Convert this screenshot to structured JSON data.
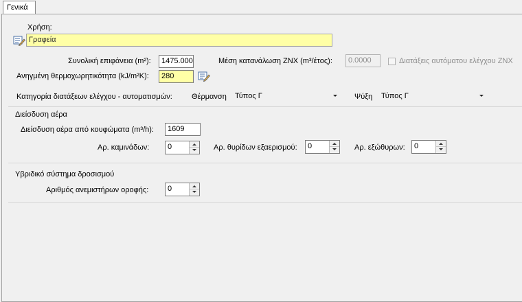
{
  "tab": {
    "label": "Γενικά"
  },
  "usage": {
    "label": "Χρήση:",
    "value": "Γραφεία"
  },
  "total_area": {
    "label": "Συνολική επιφάνεια (m²):",
    "value": "1475.000"
  },
  "dhw": {
    "label": "Μέση κατανάλωση ΖΝΧ (m³/έτος):",
    "value": "0.0000"
  },
  "dhw_auto": {
    "label": "Διατάξεις αυτόματου ελέγχου ΖΝΧ",
    "checked": false
  },
  "heat_capacity": {
    "label": "Ανηγμένη θερμοχωρητικότητα (kJ/m²K):",
    "value": "280"
  },
  "control": {
    "label": "Κατηγορία διατάξεων ελέγχου - αυτοματισμών:",
    "heating_label": "Θέρμανση",
    "heating_value": "Τύπος Γ",
    "cooling_label": "Ψύξη",
    "cooling_value": "Τύπος Γ"
  },
  "infiltration": {
    "title": "Διείσδυση αέρα",
    "frames_label": "Διείσδυση αέρα από κουφώματα (m³/h):",
    "frames_value": "1609",
    "chimneys_label": "Αρ. καμινάδων:",
    "chimneys_value": "0",
    "vents_label": "Αρ. θυρίδων εξαερισμού:",
    "vents_value": "0",
    "exhaust_label": "Αρ. εξώθυρων:",
    "exhaust_value": "0"
  },
  "hybrid": {
    "title": "Υβριδικό σύστημα δροσισμού",
    "fans_label": "Αριθμός ανεμιστήρων οροφής:",
    "fans_value": "0"
  },
  "icons": {
    "edit": "edit-list-icon"
  }
}
